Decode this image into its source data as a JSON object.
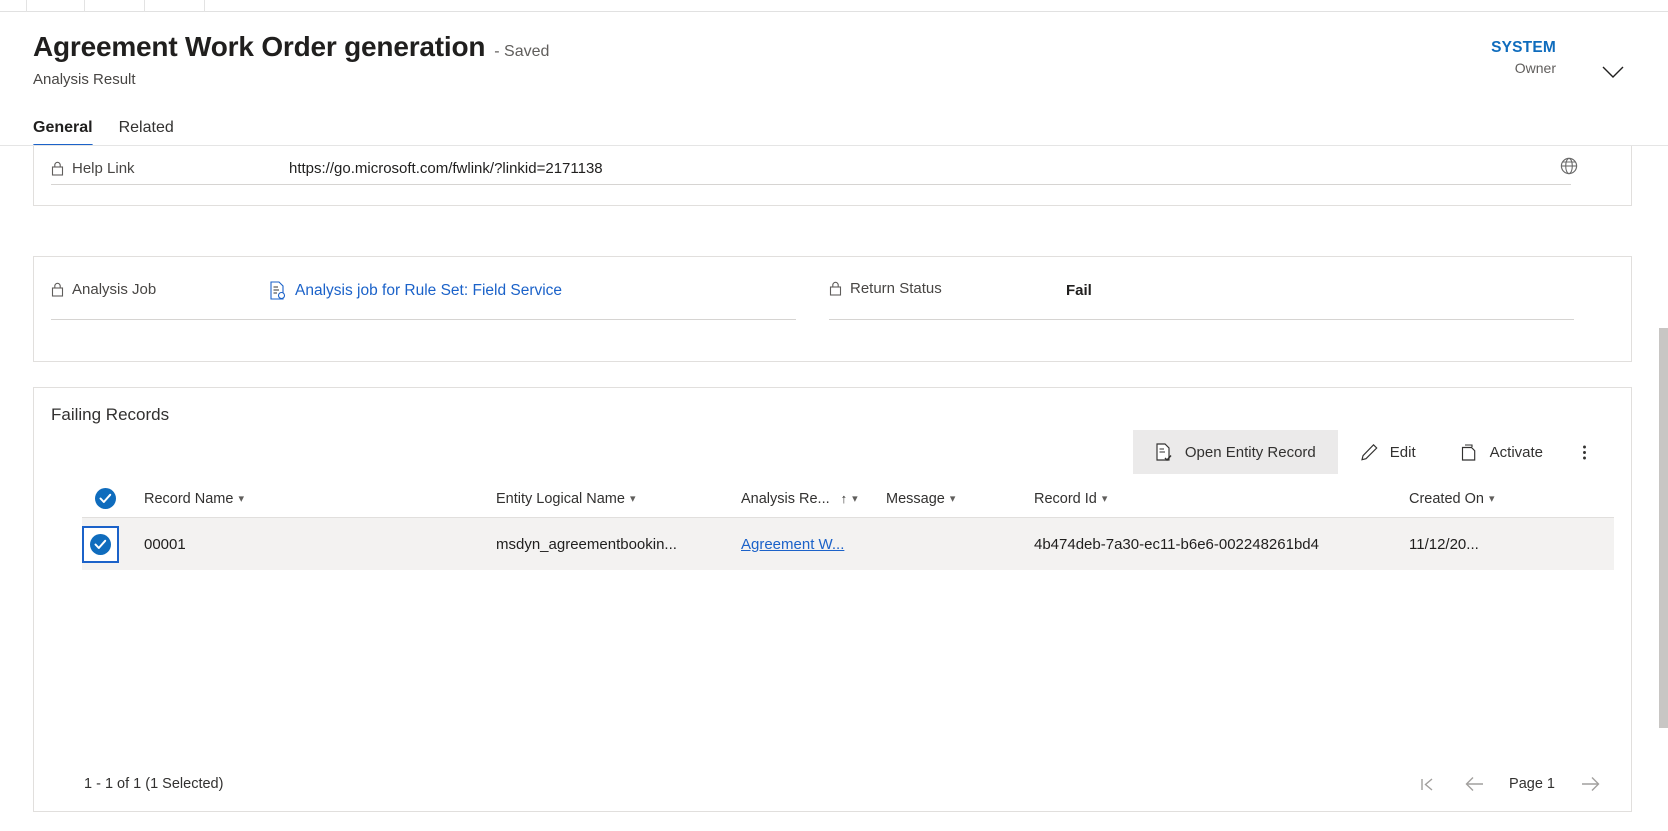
{
  "window": {
    "title": "Agreement Work Order generation",
    "save_state": "- Saved",
    "entity_label": "Analysis Result"
  },
  "owner": {
    "name": "SYSTEM",
    "role": "Owner",
    "chevron_icon": "chevron-down-icon"
  },
  "tabs": [
    {
      "label": "General",
      "active": true
    },
    {
      "label": "Related",
      "active": false
    }
  ],
  "help_section": {
    "field_label": "Help Link",
    "lock_icon": "lock-icon",
    "value": "https://go.microsoft.com/fwlink/?linkid=2171138",
    "action_icon": "globe-icon"
  },
  "job_section": {
    "analysis_job": {
      "label": "Analysis Job",
      "lock_icon": "lock-icon",
      "record_icon": "document-record-icon",
      "value": "Analysis job for Rule Set: Field Service"
    },
    "return_status": {
      "label": "Return Status",
      "lock_icon": "lock-icon",
      "value": "Fail"
    }
  },
  "subgrid": {
    "title": "Failing Records",
    "commands": [
      {
        "label": "Open Entity Record",
        "icon": "open-record-icon",
        "selected": true
      },
      {
        "label": "Edit",
        "icon": "pencil-icon",
        "selected": false
      },
      {
        "label": "Activate",
        "icon": "page-icon",
        "selected": false
      }
    ],
    "overflow_icon": "more-vertical-icon",
    "select_all_icon": "checked-circle-icon",
    "columns": [
      {
        "label": "Record Name",
        "sort": ""
      },
      {
        "label": "Entity Logical Name",
        "sort": ""
      },
      {
        "label": "Analysis Re...",
        "sort": "asc"
      },
      {
        "label": "Message",
        "sort": ""
      },
      {
        "label": "Record Id",
        "sort": ""
      },
      {
        "label": "Created On",
        "sort": ""
      }
    ],
    "rows": [
      {
        "selected": true,
        "record_name": "00001",
        "entity_logical_name": "msdyn_agreementbookin...",
        "analysis_result": "Agreement W...",
        "message": "",
        "record_id": "4b474deb-7a30-ec11-b6e6-002248261bd4",
        "created_on": "11/12/20..."
      }
    ],
    "footer": {
      "count_text": "1 - 1 of 1 (1 Selected)",
      "first_page_icon": "first-page-icon",
      "previous_page_icon": "arrow-left-icon",
      "page_label": "Page 1",
      "next_page_icon": "arrow-right-icon"
    }
  },
  "colors": {
    "accent": "#1b62c9",
    "link": "#1b62c9",
    "owner_link": "#0f6cbd",
    "selected_row": "#f3f2f1",
    "command_selected": "#ebeaea",
    "card_border": "#e1dfdd"
  }
}
